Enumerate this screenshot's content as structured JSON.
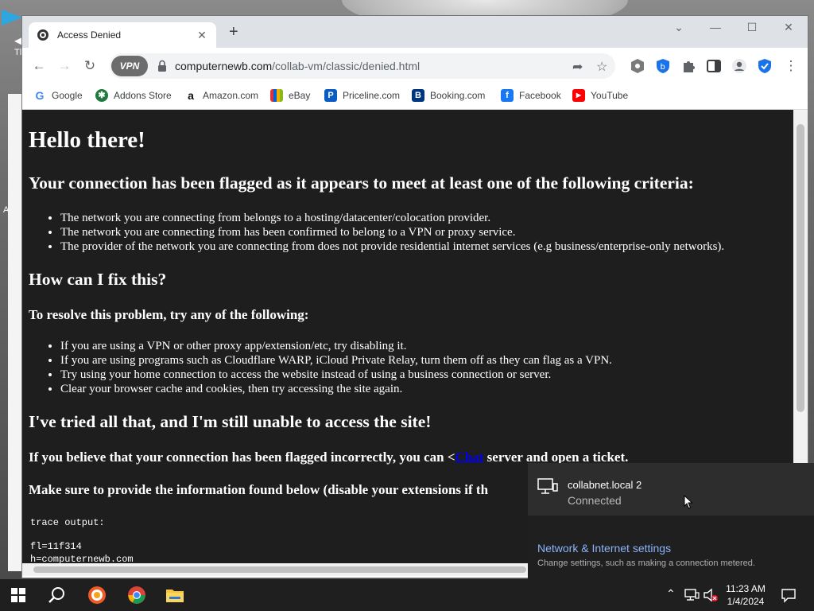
{
  "desktop": {
    "side_text_1": "Tl",
    "side_text_2": "A"
  },
  "browser": {
    "tab_title": "Access Denied",
    "url_host": "computernewb.com",
    "url_path": "/collab-vm/classic/denied.html",
    "vpn_label": "VPN",
    "bookmarks": [
      {
        "label": "Google",
        "color": "#4285f4",
        "glyph": "G"
      },
      {
        "label": "Addons Store",
        "color": "#1e7a3d",
        "glyph": "✱"
      },
      {
        "label": "Amazon.com",
        "color": "#ffffff",
        "glyph": "a"
      },
      {
        "label": "eBay",
        "color": "#e53238",
        "glyph": "▦"
      },
      {
        "label": "Priceline.com",
        "color": "#0a5cc5",
        "glyph": "P"
      },
      {
        "label": "Booking.com",
        "color": "#003580",
        "glyph": "B"
      },
      {
        "label": "Facebook",
        "color": "#1877f2",
        "glyph": "f"
      },
      {
        "label": "YouTube",
        "color": "#ff0000",
        "glyph": "▶"
      }
    ]
  },
  "page": {
    "heading": "Hello there!",
    "criteria_heading": "Your connection has been flagged as it appears to meet at least one of the following criteria:",
    "criteria": [
      "The network you are connecting from belongs to a hosting/datacenter/colocation provider.",
      "The network you are connecting from has been confirmed to belong to a VPN or proxy service.",
      "The provider of the network you are connecting from does not provide residential internet services (e.g business/enterprise-only networks)."
    ],
    "fix_heading": "How can I fix this?",
    "resolve_heading": "To resolve this problem, try any of the following:",
    "fixes": [
      "If you are using a VPN or other proxy app/extension/etc, try disabling it.",
      "If you are using programs such as Cloudflare WARP, iCloud Private Relay, turn them off as they can flag as a VPN.",
      "Try using your home connection to access the website instead of using a business connection or server.",
      "Clear your browser cache and cookies, then try accessing the site again."
    ],
    "tried_heading": "I've tried all that, and I'm still unable to access the site!",
    "incorrect_prefix": "If you believe that your connection has been flagged incorrectly, you can <",
    "incorrect_link": "Chat",
    "incorrect_suffix": " server and open a ticket.",
    "provide_text": "Make sure to provide the information found below (disable your extensions if th",
    "trace_label": "trace output:",
    "trace_line_1": "fl=11f314",
    "trace_line_2": "h=computernewb.com"
  },
  "network_flyout": {
    "name": "collabnet.local 2",
    "status": "Connected",
    "settings_link": "Network & Internet settings",
    "settings_desc": "Change settings, such as making a connection metered."
  },
  "taskbar": {
    "time": "11:23 AM",
    "date": "1/4/2024"
  }
}
